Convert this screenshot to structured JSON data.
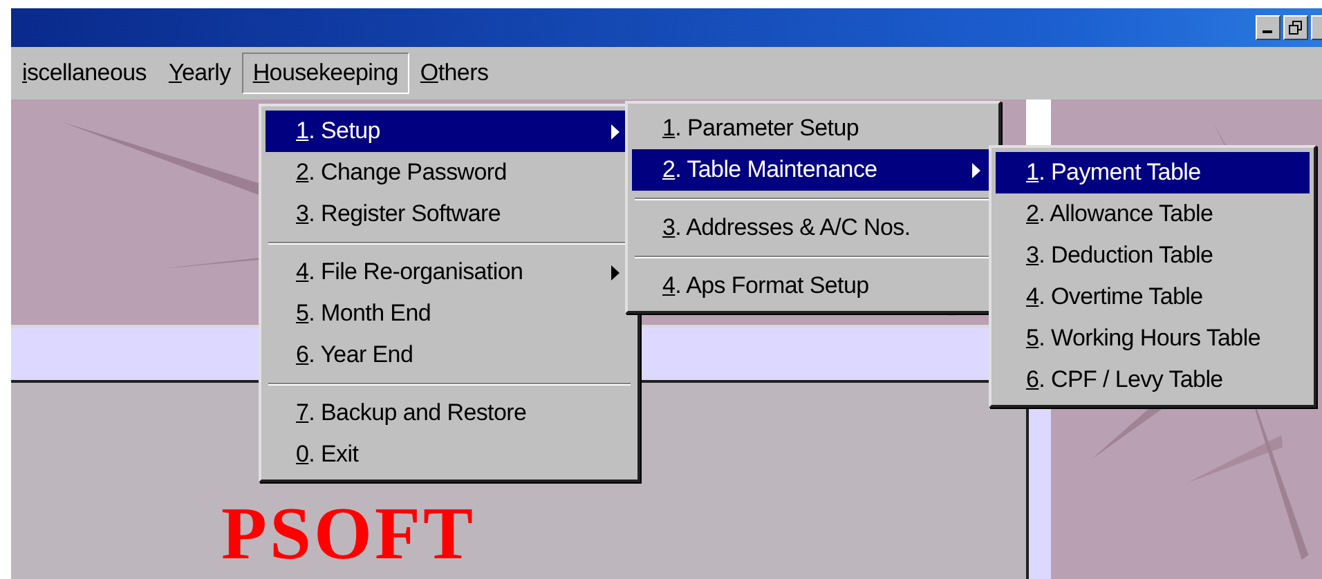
{
  "menu_bar": [
    {
      "label": "iscellaneous",
      "selected": false
    },
    {
      "label": "Yearly",
      "selected": false
    },
    {
      "label": "Housekeeping",
      "selected": true
    },
    {
      "label": "Others",
      "selected": false
    }
  ],
  "menus": [
    {
      "items": [
        {
          "kind": "item",
          "label": "1. Setup",
          "selected": true,
          "submenu": true
        },
        {
          "kind": "item",
          "label": "2. Change Password",
          "selected": false,
          "submenu": false
        },
        {
          "kind": "item",
          "label": "3. Register Software",
          "selected": false,
          "submenu": false
        },
        {
          "kind": "separator"
        },
        {
          "kind": "item",
          "label": "4. File Re-organisation",
          "selected": false,
          "submenu": true
        },
        {
          "kind": "item",
          "label": "5. Month End",
          "selected": false,
          "submenu": false
        },
        {
          "kind": "item",
          "label": "6. Year End",
          "selected": false,
          "submenu": false
        },
        {
          "kind": "separator"
        },
        {
          "kind": "item",
          "label": "7. Backup and Restore",
          "selected": false,
          "submenu": false
        },
        {
          "kind": "item",
          "label": "0. Exit",
          "selected": false,
          "submenu": false
        }
      ]
    },
    {
      "items": [
        {
          "kind": "item",
          "label": "1. Parameter Setup",
          "selected": false,
          "submenu": false
        },
        {
          "kind": "item",
          "label": "2. Table Maintenance",
          "selected": true,
          "submenu": true
        },
        {
          "kind": "separator"
        },
        {
          "kind": "item",
          "label": "3. Addresses & A/C Nos.",
          "selected": false,
          "submenu": false
        },
        {
          "kind": "separator"
        },
        {
          "kind": "item",
          "label": "4. Aps Format Setup",
          "selected": false,
          "submenu": false
        }
      ]
    },
    {
      "items": [
        {
          "kind": "item",
          "label": "1. Payment Table",
          "selected": true,
          "submenu": false
        },
        {
          "kind": "item",
          "label": "2. Allowance Table",
          "selected": false,
          "submenu": false
        },
        {
          "kind": "item",
          "label": "3. Deduction Table",
          "selected": false,
          "submenu": false
        },
        {
          "kind": "item",
          "label": "4. Overtime Table",
          "selected": false,
          "submenu": false
        },
        {
          "kind": "item",
          "label": "5. Working Hours Table",
          "selected": false,
          "submenu": false
        },
        {
          "kind": "item",
          "label": "6. CPF / Levy Table",
          "selected": false,
          "submenu": false
        }
      ]
    }
  ],
  "logo": "PSOFT"
}
